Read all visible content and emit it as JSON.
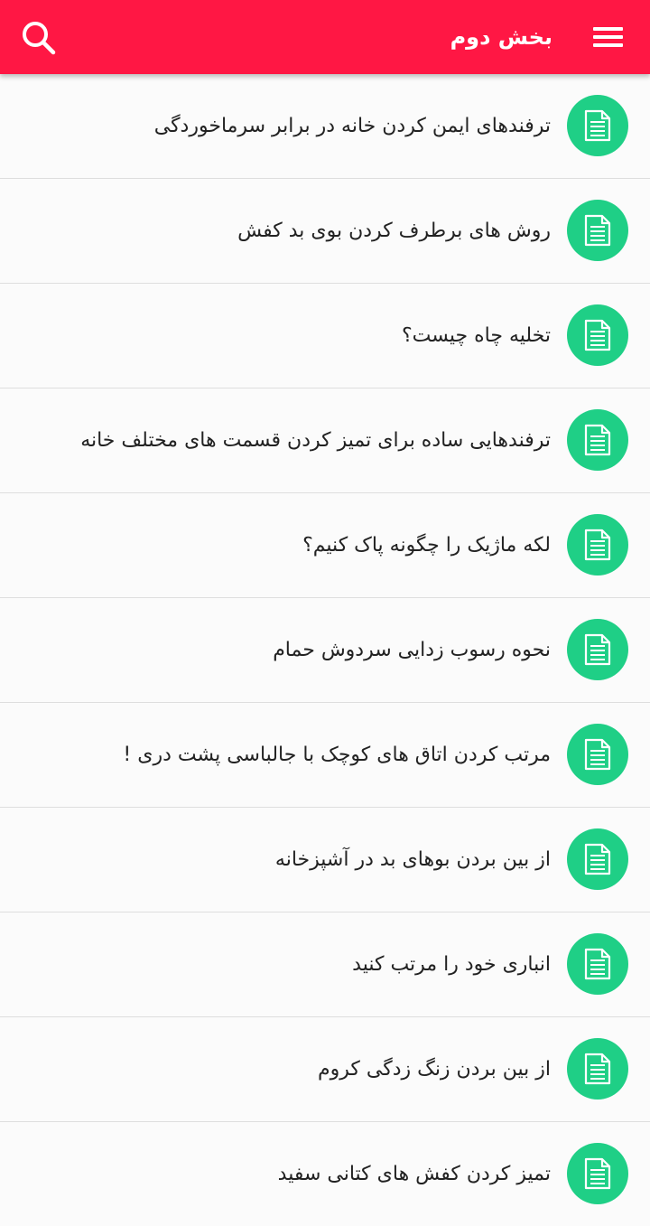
{
  "colors": {
    "appbar": "#ff1744",
    "avatar": "#1fcf86",
    "text": "#222222",
    "divider": "#dedede"
  },
  "appbar": {
    "title": "بخش دوم",
    "menu_icon": "hamburger-menu-icon",
    "search_icon": "search-icon"
  },
  "list": {
    "item_icon": "document-icon",
    "items": [
      {
        "title": "ترفندهای ایمن کردن خانه در برابر سرماخوردگی"
      },
      {
        "title": "روش های برطرف کردن بوی بد کفش"
      },
      {
        "title": "تخلیه چاه چیست؟"
      },
      {
        "title": "ترفندهایی ساده برای تمیز کردن قسمت های مختلف خانه"
      },
      {
        "title": "لکه ماژیک را چگونه پاک کنیم؟"
      },
      {
        "title": "نحوه رسوب زدایی سردوش حمام"
      },
      {
        "title": "مرتب کردن اتاق های کوچک با جالباسی پشت دری !"
      },
      {
        "title": "از بین بردن بوهای بد در آشپزخانه"
      },
      {
        "title": "انباری خود را مرتب کنید"
      },
      {
        "title": "از بین بردن زنگ زدگی کروم"
      },
      {
        "title": "تمیز کردن کفش های کتانی سفید"
      }
    ]
  }
}
